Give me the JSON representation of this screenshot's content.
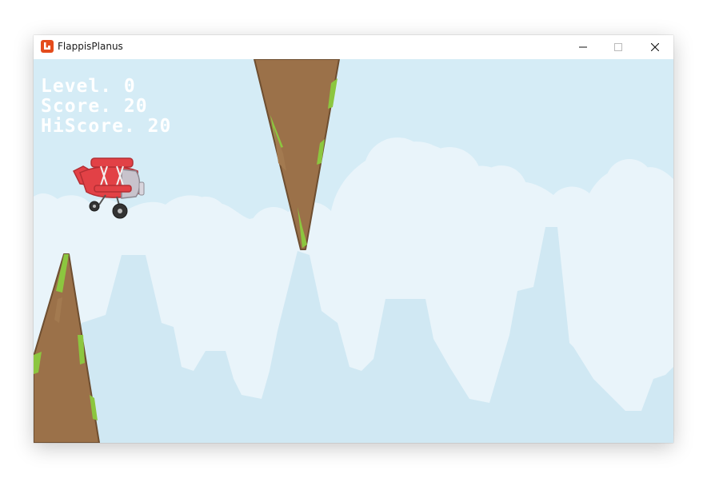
{
  "window": {
    "title": "FlappisPlanus",
    "app_icon": "monogame-icon",
    "controls": [
      "minimize-icon",
      "maximize-icon",
      "close-icon"
    ]
  },
  "hud": {
    "level": "Level. 0",
    "score": "Score. 20",
    "hiscore": "HiScore. 20"
  },
  "colors": {
    "sky": "#d5ecf6",
    "clouds": "#e9f4fa",
    "mountains": "#d0e8f3",
    "rock": "#9b7149",
    "grass": "#8cc63f",
    "plane_body": "#e24146",
    "hud_text": "#ffffff",
    "app_icon": "#e44c1c"
  }
}
